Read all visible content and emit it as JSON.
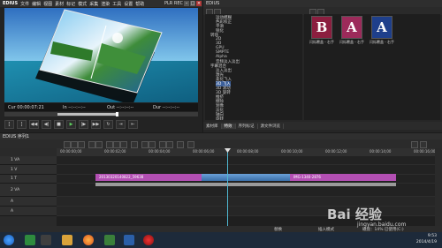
{
  "player": {
    "app_logo": "EDIUS",
    "menu": [
      "文件",
      "编辑",
      "视图",
      "素材",
      "标记",
      "模式",
      "采集",
      "渲染",
      "工具",
      "设置",
      "帮助"
    ],
    "mode_label": "PLR REC",
    "timecodes": {
      "cur": "Cur 00:00:07:21",
      "in": "In --:--:--:--",
      "out": "Out --:--:--:--",
      "dur": "Dur --:--:--:--"
    },
    "transport_icons": [
      "in-point-icon",
      "out-point-icon",
      "rewind-icon",
      "step-back-icon",
      "stop-icon",
      "play-icon",
      "step-forward-icon",
      "fast-forward-icon",
      "loop-icon",
      "insert-icon",
      "overwrite-icon"
    ]
  },
  "effects_panel": {
    "tree_items": [
      {
        "label": "运动模糊",
        "indent": 2
      },
      {
        "label": "色彩校正",
        "indent": 2
      },
      {
        "label": "平滑",
        "indent": 2
      },
      {
        "label": "锐化",
        "indent": 2
      },
      {
        "label": "转场",
        "indent": 1
      },
      {
        "label": "2D",
        "indent": 2
      },
      {
        "label": "3D",
        "indent": 2
      },
      {
        "label": "GPU",
        "indent": 2
      },
      {
        "label": "SMPTE",
        "indent": 2
      },
      {
        "label": "Alpha",
        "indent": 2
      },
      {
        "label": "音频淡入淡出",
        "indent": 2
      },
      {
        "label": "字幕混合",
        "indent": 1
      },
      {
        "label": "淡入淡出",
        "indent": 2
      },
      {
        "label": "激光",
        "indent": 2
      },
      {
        "label": "柔化飞入",
        "indent": 2
      },
      {
        "label": "3D 飞入",
        "indent": 2
      },
      {
        "label": "3D 滚动",
        "indent": 2
      },
      {
        "label": "3D 旋转",
        "indent": 2
      },
      {
        "label": "推挤",
        "indent": 2
      },
      {
        "label": "擦除",
        "indent": 2
      },
      {
        "label": "划像",
        "indent": 2
      },
      {
        "label": "淡化",
        "indent": 2
      },
      {
        "label": "轴向",
        "indent": 2
      },
      {
        "label": "旋转",
        "indent": 2
      }
    ],
    "fx_cards": [
      {
        "letter": "B",
        "label": "闪烁覆盖 - 右手",
        "color": "#8b1e3f"
      },
      {
        "letter": "A",
        "label": "闪烁覆盖 - 右手",
        "color": "#9c2a5a"
      },
      {
        "letter": "A",
        "label": "闪烁覆盖 - 右手",
        "color": "#1e3f8b"
      }
    ],
    "tabs": [
      "素材库",
      "特效",
      "序列标记",
      "源文件浏览"
    ]
  },
  "timeline": {
    "title": "EDIUS 序列1",
    "ruler_ticks": [
      "00:00:00;00",
      "00:00:02;00",
      "00:00:04;00",
      "00:00:06;00",
      "00:00:08;00",
      "00:00:10;00",
      "00:00:12;00",
      "00:00:14;00",
      "00:00:16;00"
    ],
    "tracks": [
      {
        "name": "1 VA",
        "kind": "va"
      },
      {
        "name": "1 V",
        "kind": "v"
      },
      {
        "name": "1 T",
        "kind": "t"
      },
      {
        "name": "2 VA",
        "kind": "va"
      },
      {
        "name": "A",
        "kind": "a"
      },
      {
        "name": "A",
        "kind": "a"
      }
    ],
    "clips": {
      "clip1": "20130320140822_59638",
      "clip2": "IMG-1340-2876"
    },
    "status": {
      "left": "替换",
      "mid": "插入模式",
      "right": "磁盘：14% 已使用(C:)"
    }
  },
  "watermark": {
    "main": "Bai  经验",
    "sub": "jingyan.baidu.com"
  },
  "taskbar": {
    "time": "9:53",
    "date": "2014/4/19"
  }
}
